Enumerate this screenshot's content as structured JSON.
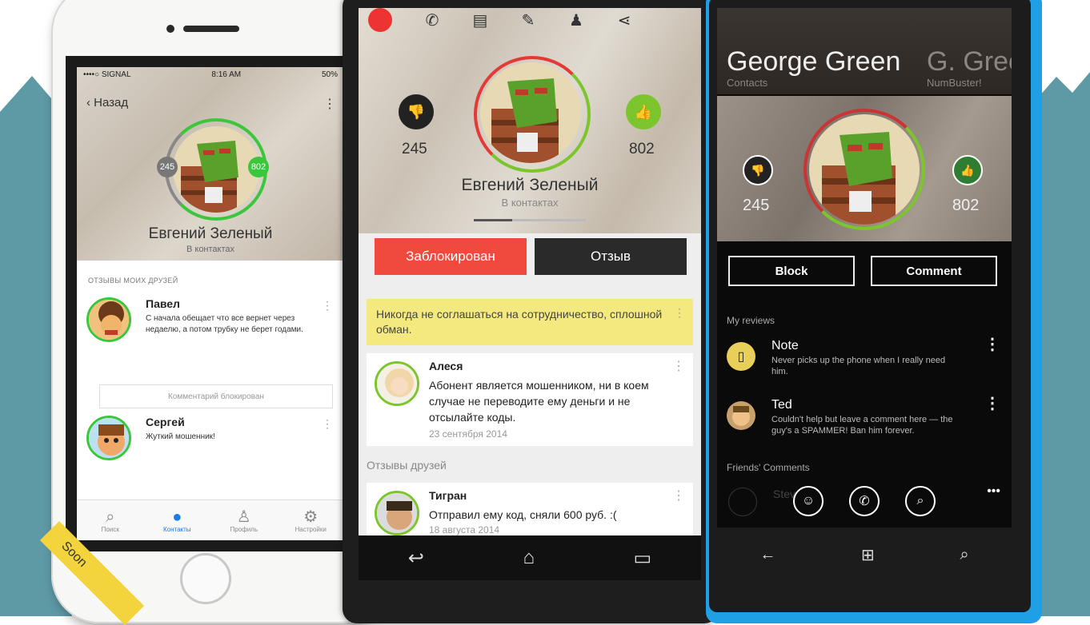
{
  "iphone": {
    "status": {
      "carrier": "••••○ SIGNAL",
      "time": "8:16 AM",
      "battery": "50%"
    },
    "back_label": "Назад",
    "profile": {
      "name": "Евгений Зеленый",
      "subtitle": "В контактах",
      "dislikes": "245",
      "likes": "802"
    },
    "section_title": "ОТЗЫВЫ МОИХ ДРУЗЕЙ",
    "reviews": [
      {
        "name": "Павел",
        "text": "С начала обещает что все вернет через недаелю, а потом трубку не берет годами."
      },
      {
        "name": "Сергей",
        "text": "Жуткий мошенник!"
      }
    ],
    "blocked_comment": "Комментарий блокирован",
    "tabs": [
      {
        "label": "Поиск",
        "icon": "search-icon"
      },
      {
        "label": "Контакты",
        "icon": "contacts-icon"
      },
      {
        "label": "Профиль",
        "icon": "profile-icon"
      },
      {
        "label": "Настройки",
        "icon": "settings-icon"
      }
    ],
    "soon_label": "Soon"
  },
  "android": {
    "profile": {
      "name": "Евгений Зеленый",
      "subtitle": "В контактах",
      "dislikes": "245",
      "likes": "802"
    },
    "block_button": "Заблокирован",
    "review_button": "Отзыв",
    "warning": "Никогда не соглашаться на сотрудничество, сплошной обман.",
    "reviews": [
      {
        "name": "Алеся",
        "text": "Абонент является мошенником,  ни в коем случае не переводите ему деньги и не отсылайте коды.",
        "date": "23 сентября 2014"
      },
      {
        "name": "Тигран",
        "text": "Отправил ему код, сняли 600 руб. :(",
        "date": "18 августа 2014"
      }
    ],
    "friends_section": "Отзывы друзей"
  },
  "winphone": {
    "title": "George Green",
    "title_next": "G. Gree",
    "subtitle": "Contacts",
    "subtitle_next": "NumBuster!",
    "dislikes": "245",
    "likes": "802",
    "block_button": "Block",
    "comment_button": "Comment",
    "my_reviews": "My reviews",
    "reviews": [
      {
        "name": "Note",
        "text": "Never picks up the phone when I really need him."
      },
      {
        "name": "Ted",
        "text": "Couldn't help but leave a comment here — the guy's a SPAMMER! Ban him forever."
      }
    ],
    "friends_comments": "Friends' Comments",
    "partial_name": "Stev"
  },
  "colors": {
    "accent_green": "#7cc52c",
    "accent_red": "#e53935",
    "warning_yellow": "#f3e97f",
    "ios_blue": "#1a7be0",
    "wp_blue": "#1fa0e6"
  }
}
